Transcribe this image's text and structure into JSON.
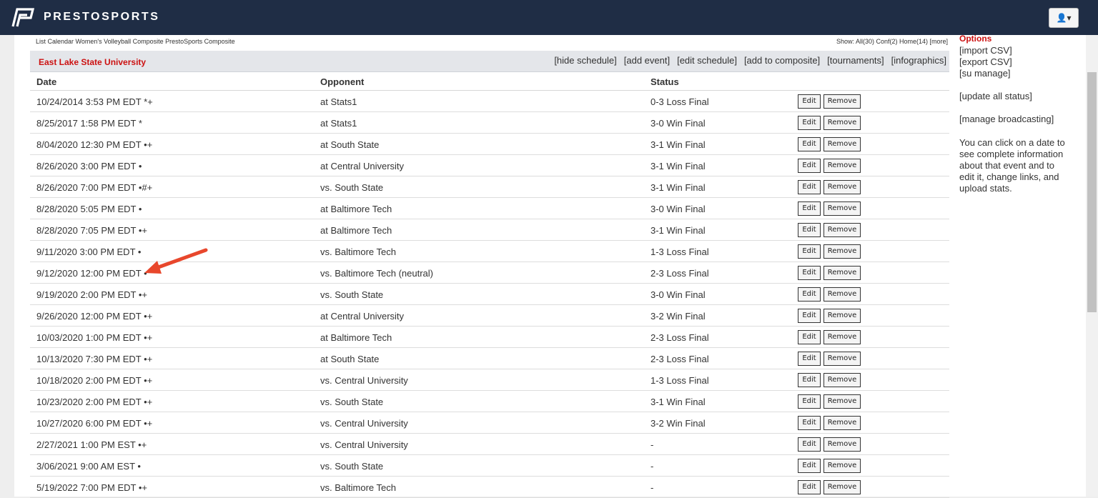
{
  "brand": {
    "name": "PRESTOSPORTS",
    "user_menu": "▾"
  },
  "breadcrumb": "List Calendar Women's Volleyball Composite PrestoSports Composite",
  "show_filter": "Show: All(30) Conf(2) Home(14) [more]",
  "schedule": {
    "school": "East Lake State University",
    "links": [
      "[hide schedule]",
      "[add event]",
      "[edit schedule]",
      "[add to composite]",
      "[tournaments]",
      "[infographics]"
    ],
    "columns": {
      "date": "Date",
      "opponent": "Opponent",
      "status": "Status"
    },
    "edit_label": "Edit",
    "remove_label": "Remove",
    "rows": [
      {
        "date": "10/24/2014 3:53 PM EDT *+",
        "opponent": "at Stats1",
        "status": "0-3 Loss Final"
      },
      {
        "date": "8/25/2017 1:58 PM EDT *",
        "opponent": "at Stats1",
        "status": "3-0 Win Final"
      },
      {
        "date": "8/04/2020 12:30 PM EDT •+",
        "opponent": "at South State",
        "status": "3-1 Win Final"
      },
      {
        "date": "8/26/2020 3:00 PM EDT •",
        "opponent": "at Central University",
        "status": "3-1 Win Final"
      },
      {
        "date": "8/26/2020 7:00 PM EDT •#+",
        "opponent": "vs. South State",
        "status": "3-1 Win Final"
      },
      {
        "date": "8/28/2020 5:05 PM EDT •",
        "opponent": "at Baltimore Tech",
        "status": "3-0 Win Final"
      },
      {
        "date": "8/28/2020 7:05 PM EDT •+",
        "opponent": "at Baltimore Tech",
        "status": "3-1 Win Final"
      },
      {
        "date": "9/11/2020 3:00 PM EDT •",
        "opponent": "vs. Baltimore Tech",
        "status": "1-3 Loss Final"
      },
      {
        "date": "9/12/2020 12:00 PM EDT •",
        "opponent": "vs. Baltimore Tech (neutral)",
        "status": "2-3 Loss Final"
      },
      {
        "date": "9/19/2020 2:00 PM EDT •+",
        "opponent": "vs. South State",
        "status": "3-0 Win Final"
      },
      {
        "date": "9/26/2020 12:00 PM EDT •+",
        "opponent": "at Central University",
        "status": "3-2 Win Final"
      },
      {
        "date": "10/03/2020 1:00 PM EDT •+",
        "opponent": "at Baltimore Tech",
        "status": "2-3 Loss Final"
      },
      {
        "date": "10/13/2020 7:30 PM EDT •+",
        "opponent": "at South State",
        "status": "2-3 Loss Final"
      },
      {
        "date": "10/18/2020 2:00 PM EDT •+",
        "opponent": "vs. Central University",
        "status": "1-3 Loss Final"
      },
      {
        "date": "10/23/2020 2:00 PM EDT •+",
        "opponent": "vs. South State",
        "status": "3-1 Win Final"
      },
      {
        "date": "10/27/2020 6:00 PM EDT •+",
        "opponent": "vs. Central University",
        "status": "3-2 Win Final"
      },
      {
        "date": "2/27/2021 1:00 PM EST •+",
        "opponent": "vs. Central University",
        "status": "-"
      },
      {
        "date": "3/06/2021 9:00 AM EST •",
        "opponent": "vs. South State",
        "status": "-"
      },
      {
        "date": "5/19/2022 7:00 PM EDT •+",
        "opponent": "vs. Baltimore Tech",
        "status": "-"
      }
    ]
  },
  "sidebar": {
    "options_title": "Options",
    "import_csv": "[import CSV]",
    "export_csv": "[export CSV]",
    "su_manage": "[su manage]",
    "update_status": "[update all status]",
    "manage_broadcasting": "[manage broadcasting]",
    "help_text": "You can click on a date to see complete information about that event and to edit it, change links, and upload stats."
  },
  "colors": {
    "topbar": "#1f2d45",
    "accent_red": "#cc1111",
    "annotation_arrow": "#e8472c"
  }
}
